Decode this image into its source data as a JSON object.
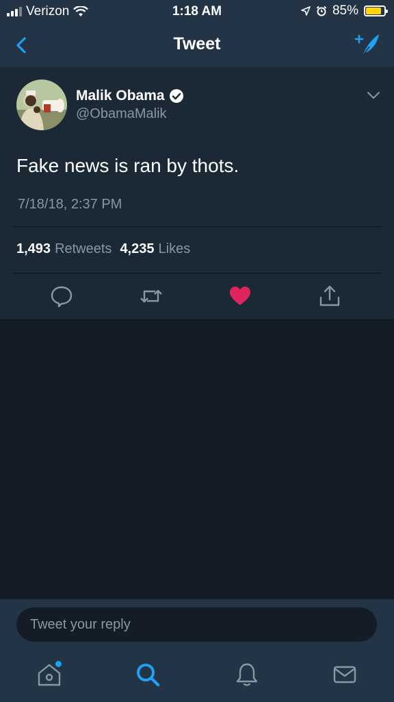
{
  "status_bar": {
    "carrier": "Verizon",
    "time": "1:18 AM",
    "battery": "85%",
    "battery_level": 0.85
  },
  "nav": {
    "title": "Tweet",
    "back_icon": "chevron-left-icon",
    "compose_icon": "compose-tweet-icon"
  },
  "tweet": {
    "author_name": "Malik Obama",
    "handle": "@ObamaMalik",
    "verified": true,
    "text": "Fake news is ran by thots.",
    "timestamp": "7/18/18, 2:37 PM",
    "retweets_count": "1,493",
    "retweets_label": "Retweets",
    "likes_count": "4,235",
    "likes_label": "Likes",
    "liked": true
  },
  "actions": [
    "reply-icon",
    "retweet-icon",
    "like-icon",
    "share-icon"
  ],
  "reply_box": {
    "placeholder": "Tweet your reply"
  },
  "tab_bar": [
    "home-icon",
    "search-icon",
    "notifications-icon",
    "messages-icon"
  ],
  "colors": {
    "accent": "#1da1f2",
    "like": "#e0245e",
    "background": "#141d26",
    "panel": "#1b2836",
    "bar": "#243447",
    "muted_text": "#8899a6"
  }
}
